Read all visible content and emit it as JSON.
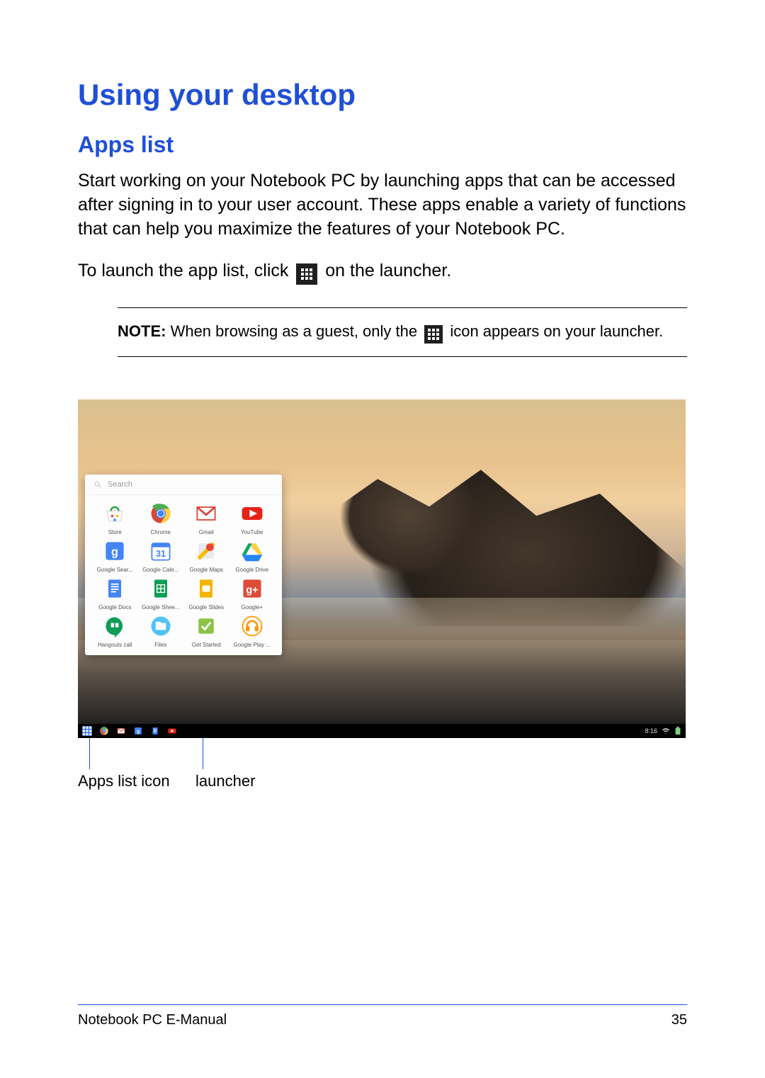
{
  "heading": "Using your desktop",
  "subheading": "Apps list",
  "para1": "Start working on your Notebook PC by launching apps that can be accessed after signing in to your user account. These apps enable a variety of functions that can help you maximize the features of your Notebook PC.",
  "para2_pre": "To launch the app list, click ",
  "para2_post": " on the launcher.",
  "note": {
    "label": "NOTE:",
    "pre": " When browsing as a guest, only the ",
    "post": " icon appears on your launcher."
  },
  "launcher_panel": {
    "search_placeholder": "Search",
    "apps": [
      {
        "name": "Store",
        "icon": "store"
      },
      {
        "name": "Chrome",
        "icon": "chrome"
      },
      {
        "name": "Gmail",
        "icon": "gmail"
      },
      {
        "name": "YouTube",
        "icon": "youtube"
      },
      {
        "name": "Google Sear...",
        "icon": "gsearch"
      },
      {
        "name": "Google Cale...",
        "icon": "calendar"
      },
      {
        "name": "Google Maps",
        "icon": "maps"
      },
      {
        "name": "Google Drive",
        "icon": "drive"
      },
      {
        "name": "Google Docs",
        "icon": "docs"
      },
      {
        "name": "Google Shee...",
        "icon": "sheets"
      },
      {
        "name": "Google Slides",
        "icon": "slides"
      },
      {
        "name": "Google+",
        "icon": "gplus"
      },
      {
        "name": "Hangouts call",
        "icon": "hangouts"
      },
      {
        "name": "Files",
        "icon": "files"
      },
      {
        "name": "Get Started",
        "icon": "start"
      },
      {
        "name": "Google Play ...",
        "icon": "play"
      }
    ]
  },
  "shelf": {
    "icons": [
      "apps",
      "chrome",
      "gmail",
      "gsearch",
      "docs",
      "youtube"
    ],
    "tray_text": "8:16"
  },
  "callouts": {
    "apps_list_icon": "Apps list icon",
    "launcher": "launcher"
  },
  "footer": {
    "left": "Notebook PC E-Manual",
    "right": "35"
  },
  "colors": {
    "accent": "#1f4fd6"
  }
}
